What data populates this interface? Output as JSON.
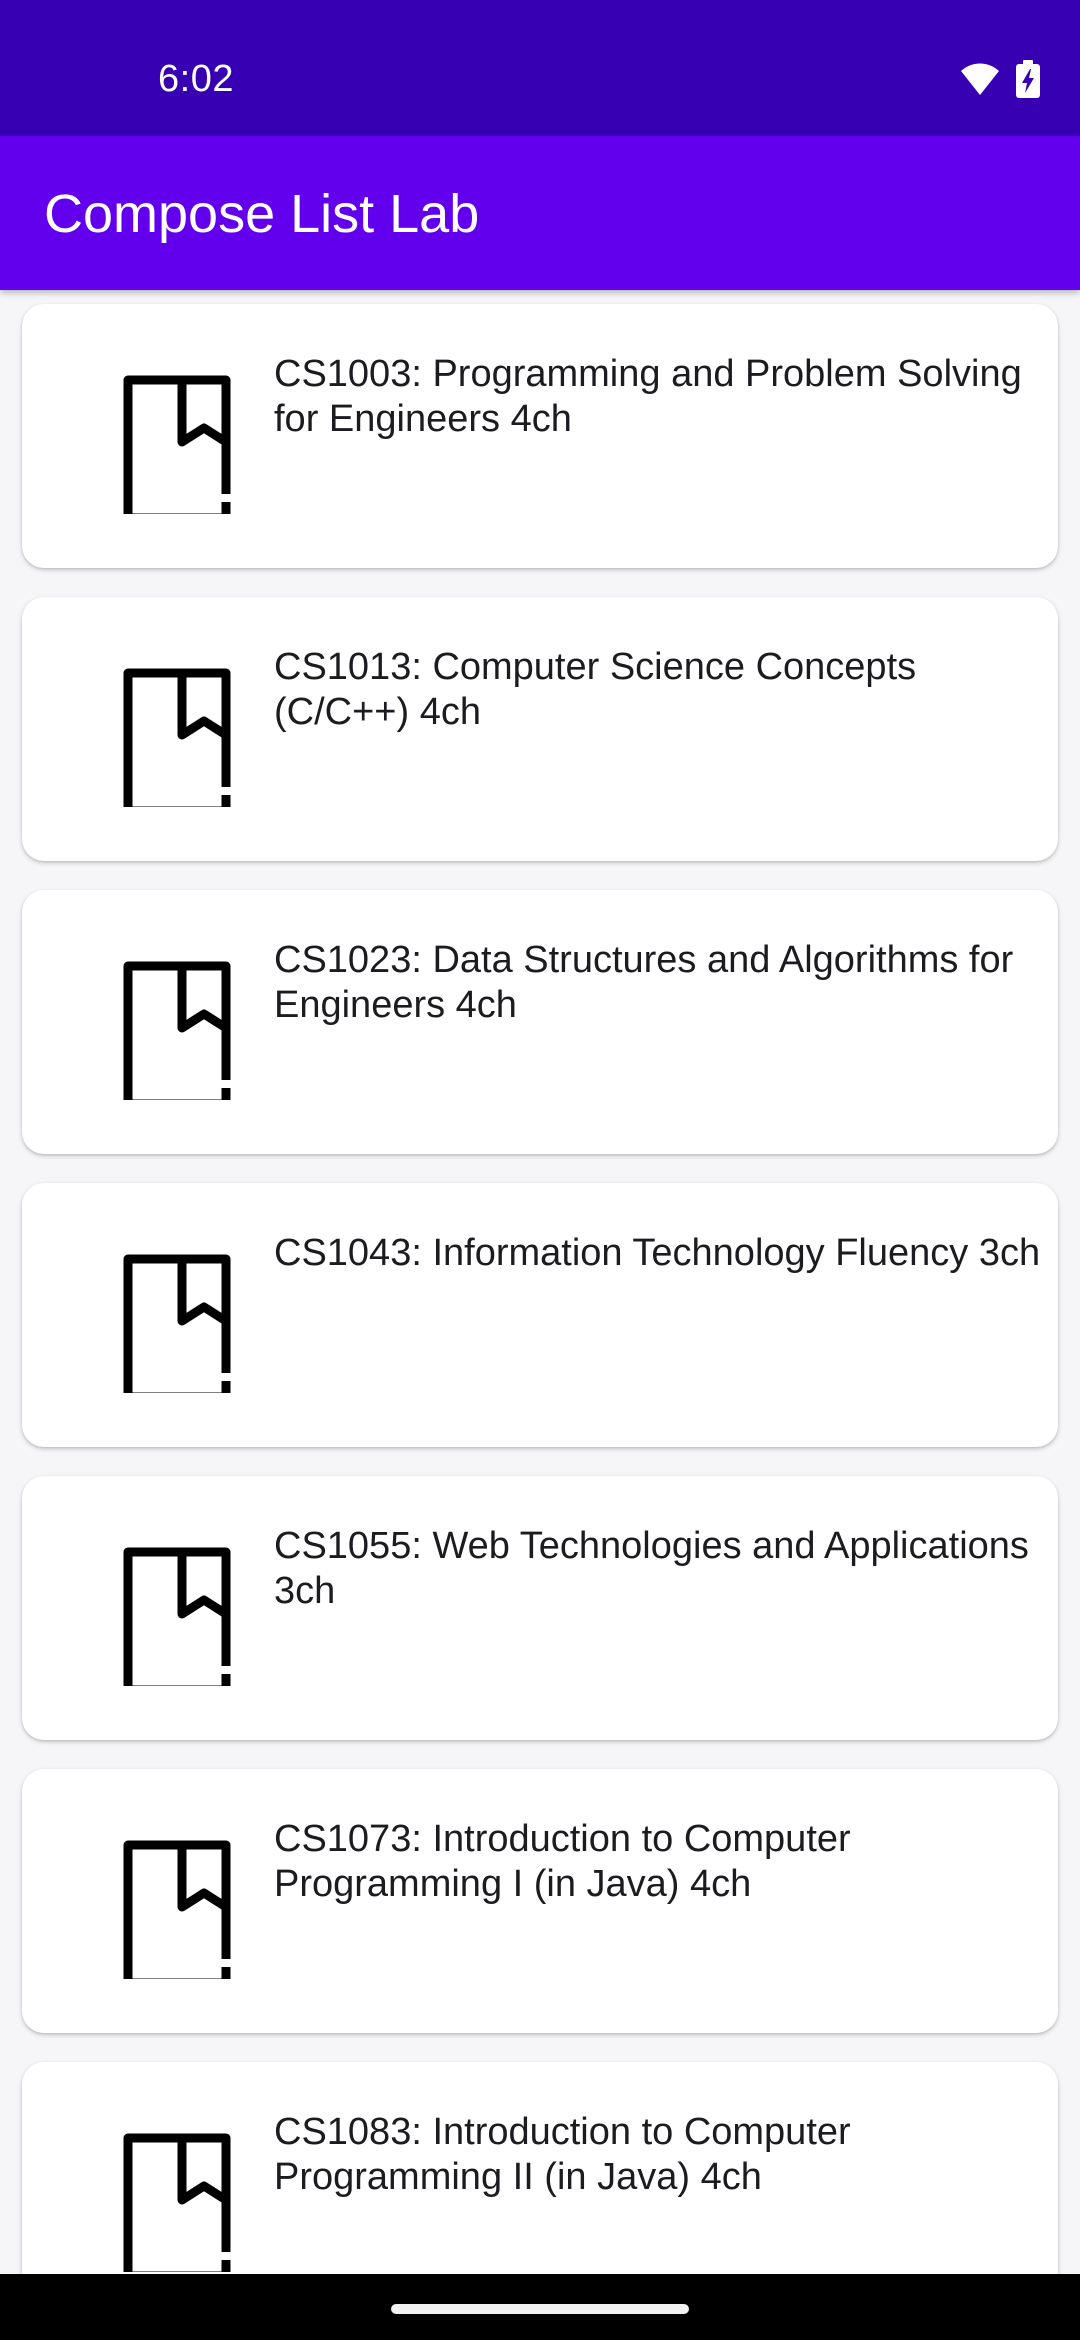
{
  "status_bar": {
    "time": "6:02",
    "icons": [
      "wifi-icon",
      "battery-charging-icon"
    ]
  },
  "app_bar": {
    "title": "Compose List Lab"
  },
  "courses": [
    {
      "label": "CS1003: Programming and Problem Solving for Engineers 4ch",
      "icon": "book-bookmark-icon"
    },
    {
      "label": "CS1013: Computer Science Concepts (C/C++) 4ch",
      "icon": "book-bookmark-icon"
    },
    {
      "label": "CS1023: Data Structures and Algorithms for Engineers 4ch",
      "icon": "book-bookmark-icon"
    },
    {
      "label": "CS1043: Information Technology Fluency 3ch",
      "icon": "book-bookmark-icon"
    },
    {
      "label": "CS1055: Web Technologies and Applications 3ch",
      "icon": "book-bookmark-icon"
    },
    {
      "label": "CS1073: Introduction to Computer Programming I (in Java) 4ch",
      "icon": "book-bookmark-icon"
    },
    {
      "label": "CS1083: Introduction to Computer Programming II (in Java) 4ch",
      "icon": "book-bookmark-icon"
    }
  ],
  "colors": {
    "status_bar": "#3700b3",
    "app_bar": "#6200ee",
    "background": "#f6f5f8",
    "card": "#ffffff",
    "text": "#1c1b1f"
  }
}
